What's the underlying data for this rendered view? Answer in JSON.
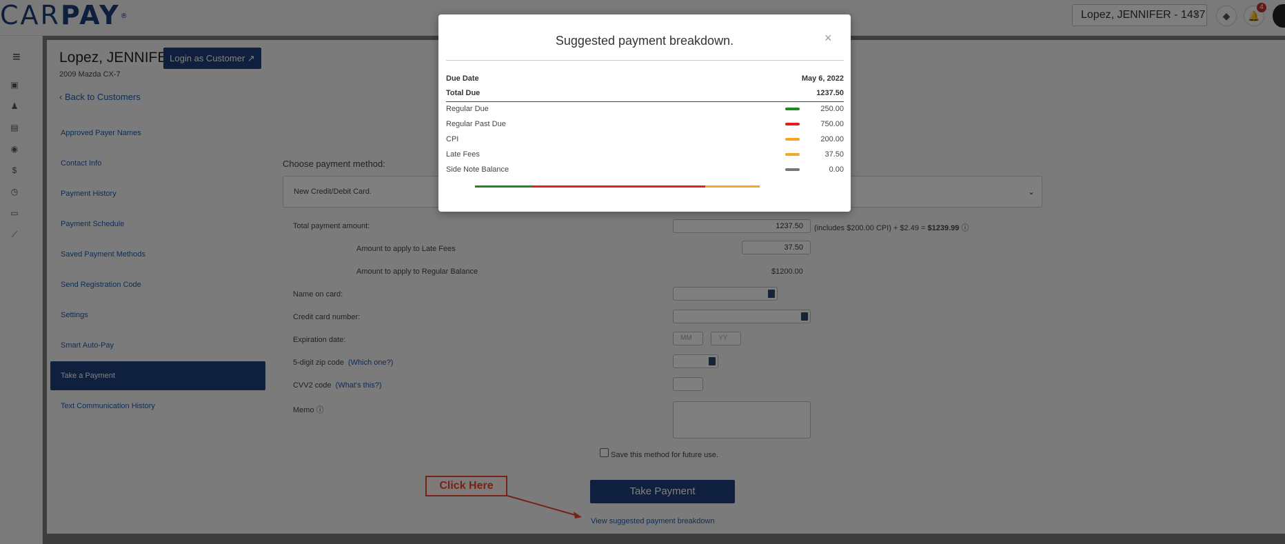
{
  "brand": {
    "logo_light": "CAR",
    "logo_bold": "PAY",
    "logo_reg": "®"
  },
  "header": {
    "customer_selector": "Lopez, JENNIFER - 1437",
    "notification_count": "4"
  },
  "customer": {
    "name": "Lopez, JENNIFER",
    "login_button": "Login as Customer",
    "vehicle": "2009 Mazda CX-7",
    "back_link": "Back to Customers"
  },
  "side_nav": {
    "items": [
      "Approved Payer Names",
      "Contact Info",
      "Payment History",
      "Payment Schedule",
      "Saved Payment Methods",
      "Send Registration Code",
      "Settings",
      "Smart Auto-Pay",
      "Take a Payment",
      "Text Communication History"
    ],
    "active": "Take a Payment"
  },
  "payment_form": {
    "choose_label": "Choose payment method:",
    "method_selected": "New Credit/Debit Card.",
    "total_label": "Total payment amount:",
    "total_value": "1237.50",
    "total_note_prefix": "(includes $200.00 CPI)  + $2.49 = ",
    "total_note_bold": "$1239.99",
    "late_fees_label": "Amount to apply to Late Fees",
    "late_fees_value": "37.50",
    "regular_label": "Amount to apply to Regular Balance",
    "regular_value": "$1200.00",
    "name_label": "Name on card:",
    "card_label": "Credit card number:",
    "exp_label": "Expiration date:",
    "exp_mm_placeholder": "MM",
    "exp_yy_placeholder": "YY",
    "zip_label": "5-digit zip code",
    "zip_help": "(Which one?)",
    "cvv_label": "CVV2 code",
    "cvv_help": "(What's this?)",
    "memo_label": "Memo",
    "save_label": "Save this method for future use.",
    "take_payment": "Take Payment",
    "view_breakdown": "View suggested payment breakdown"
  },
  "annotation": {
    "callout": "Click Here",
    "color": "#e8472b"
  },
  "modal": {
    "title": "Suggested payment breakdown.",
    "close": "×",
    "due_date_label": "Due Date",
    "due_date_value": "May 6, 2022",
    "total_due_label": "Total Due",
    "total_due_value": "1237.50",
    "rows": [
      {
        "label": "Regular Due",
        "value": "250.00",
        "color": "#1e8a1e"
      },
      {
        "label": "Regular Past Due",
        "value": "750.00",
        "color": "#e0201c"
      },
      {
        "label": "CPI",
        "value": "200.00",
        "color": "#f5a623"
      },
      {
        "label": "Late Fees",
        "value": "37.50",
        "color": "#f5a623"
      },
      {
        "label": "Side Note Balance",
        "value": "0.00",
        "color": "#777777"
      }
    ]
  }
}
